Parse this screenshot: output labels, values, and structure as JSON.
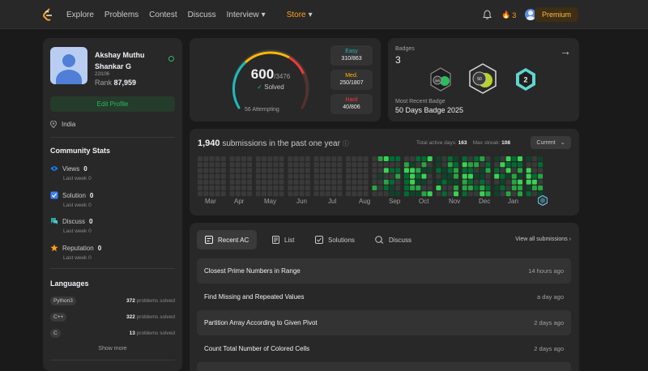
{
  "nav": {
    "links": [
      "Explore",
      "Problems",
      "Contest",
      "Discuss",
      "Interview",
      "Store"
    ],
    "streak_count": "3",
    "premium_label": "Premium"
  },
  "profile": {
    "name": "Akshay Muthu Shankar G",
    "handle": "22l106",
    "rank_label": "Rank",
    "rank_value": "87,959",
    "edit_label": "Edit Profile",
    "location": "India"
  },
  "community": {
    "title": "Community Stats",
    "items": [
      {
        "label": "Views",
        "value": "0",
        "sub": "Last week",
        "sub_val": "0",
        "icon": "eye-icon",
        "color": "#0a84ff"
      },
      {
        "label": "Solution",
        "value": "0",
        "sub": "Last week",
        "sub_val": "0",
        "icon": "solution-icon",
        "color": "#3b82f6"
      },
      {
        "label": "Discuss",
        "value": "0",
        "sub": "Last week",
        "sub_val": "0",
        "icon": "discuss-icon",
        "color": "#2ea3a3"
      },
      {
        "label": "Reputation",
        "value": "0",
        "sub": "Last week",
        "sub_val": "0",
        "icon": "star-icon",
        "color": "#ffa116"
      }
    ]
  },
  "languages": {
    "title": "Languages",
    "items": [
      {
        "name": "Python3",
        "count": "372",
        "suffix": "problems solved"
      },
      {
        "name": "C++",
        "count": "322",
        "suffix": "problems solved"
      },
      {
        "name": "C",
        "count": "13",
        "suffix": "problems solved"
      }
    ],
    "show_more": "Show more"
  },
  "solved": {
    "count": "600",
    "total": "/3476",
    "label": "Solved",
    "attempting": "56 Attempting",
    "easy": {
      "label": "Easy",
      "value": "310/863",
      "color": "#1cbaba"
    },
    "medium": {
      "label": "Med.",
      "value": "250/1807",
      "color": "#ffb700"
    },
    "hard": {
      "label": "Hard",
      "value": "40/806",
      "color": "#f63737"
    }
  },
  "badges": {
    "title": "Badges",
    "count": "3",
    "recent_label": "Most Recent Badge",
    "recent_name": "50 Days Badge 2025"
  },
  "heatmap": {
    "count": "1,940",
    "text": "submissions in the past one year",
    "active_label": "Total active days:",
    "active_value": "163",
    "streak_label": "Max streak:",
    "streak_value": "108",
    "filter": "Current",
    "months": [
      "Mar",
      "Apr",
      "May",
      "Jun",
      "Jul",
      "Aug",
      "Sep",
      "Oct",
      "Nov",
      "Dec",
      "Jan"
    ]
  },
  "recent": {
    "tabs": [
      "Recent AC",
      "List",
      "Solutions",
      "Discuss"
    ],
    "view_all": "View all submissions",
    "items": [
      {
        "title": "Closest Prime Numbers in Range",
        "time": "14 hours ago"
      },
      {
        "title": "Find Missing and Repeated Values",
        "time": "a day ago"
      },
      {
        "title": "Partition Array According to Given Pivot",
        "time": "2 days ago"
      },
      {
        "title": "Count Total Number of Colored Cells",
        "time": "2 days ago"
      }
    ]
  }
}
